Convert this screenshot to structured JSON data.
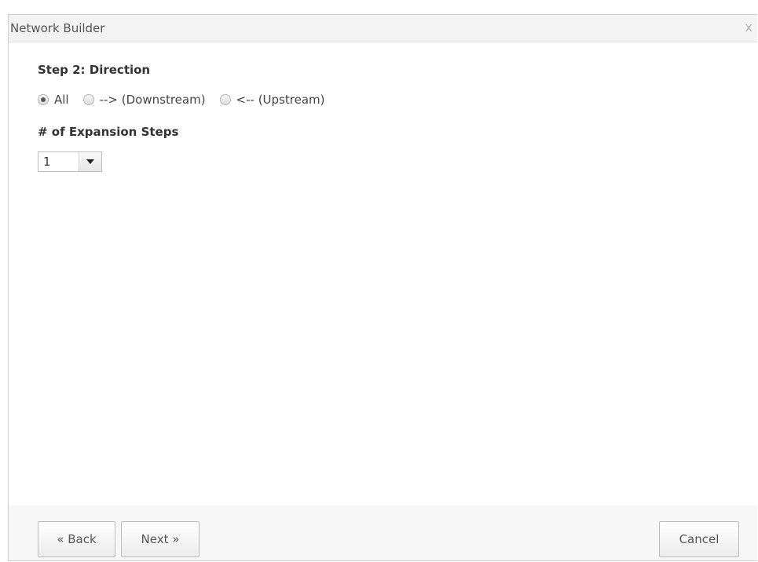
{
  "dialog": {
    "title": "Network Builder",
    "close_glyph": "x"
  },
  "step": {
    "title": "Step 2: Direction",
    "options": [
      {
        "label": "All",
        "checked": true
      },
      {
        "label": "--> (Downstream)",
        "checked": false
      },
      {
        "label": "<-- (Upstream)",
        "checked": false
      }
    ]
  },
  "expansion": {
    "title": "# of Expansion Steps",
    "selected": "1"
  },
  "buttons": {
    "back": "« Back",
    "next": "Next »",
    "cancel": "Cancel"
  }
}
